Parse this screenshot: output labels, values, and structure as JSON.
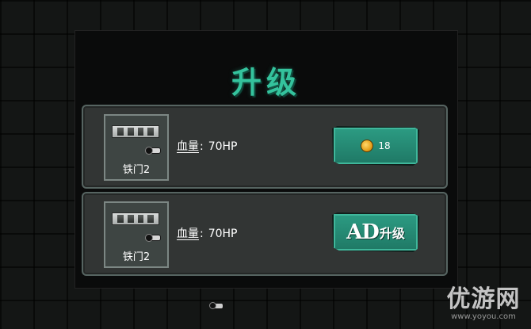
{
  "dialog": {
    "title": "升级"
  },
  "upgrades": [
    {
      "item_name": "铁门2",
      "stat_label": "血量",
      "stat_separator": ":",
      "stat_value": "70HP",
      "button": {
        "type": "coin",
        "icon": "coin-icon",
        "cost": "18"
      }
    },
    {
      "item_name": "铁门2",
      "stat_label": "血量",
      "stat_separator": ":",
      "stat_value": "70HP",
      "button": {
        "type": "ad",
        "mark": "AD",
        "label": "升级"
      }
    }
  ],
  "watermark": {
    "logo": "优游网",
    "url": "www.yoyou.com"
  },
  "colors": {
    "title": "#34c39d",
    "button": "#2c9c83",
    "panel": "#0a0b0b",
    "row": "#323534"
  }
}
